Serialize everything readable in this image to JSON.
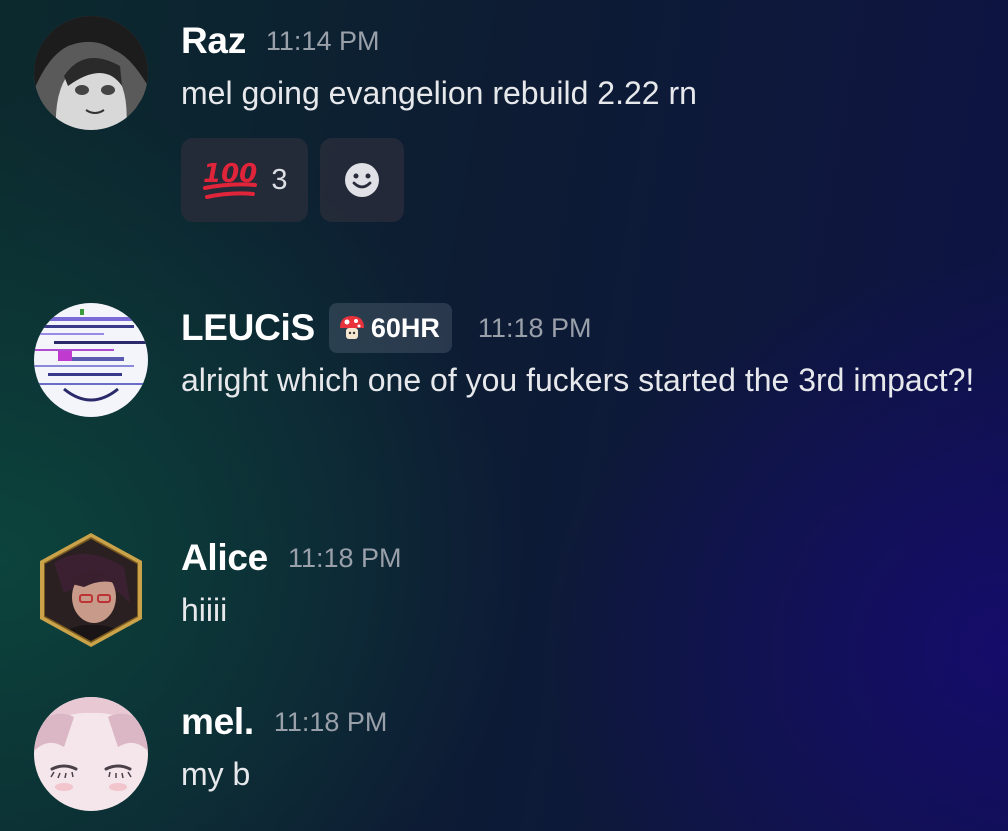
{
  "messages": [
    {
      "author": "Raz",
      "time": "11:14 PM",
      "text": "mel going evangelion rebuild 2.22 rn",
      "avatar_icon": "anime-girl-avatar",
      "reactions": [
        {
          "emoji": "hundred-points-icon",
          "count": "3"
        }
      ],
      "add_reaction_icon": "add-reaction-smiley-icon"
    },
    {
      "author": "LEUCiS",
      "tag": {
        "icon": "mushroom-icon",
        "label": "60HR"
      },
      "time": "11:18 PM",
      "text": "alright which one of you fuckers started the 3rd impact?!",
      "avatar_icon": "glitch-art-avatar"
    },
    {
      "author": "Alice",
      "time": "11:18 PM",
      "text": "hiiii",
      "avatar_icon": "hexagon-framed-avatar",
      "avatar_frame_color": "#c9a24a"
    },
    {
      "author": "mel.",
      "time": "11:18 PM",
      "text": "my b",
      "avatar_icon": "pastel-anime-avatar"
    }
  ],
  "colors": {
    "username": "#ffffff",
    "timestamp": "#9aa0aa",
    "reaction_bg": "#282c3a",
    "hundred_red": "#e0243a"
  }
}
